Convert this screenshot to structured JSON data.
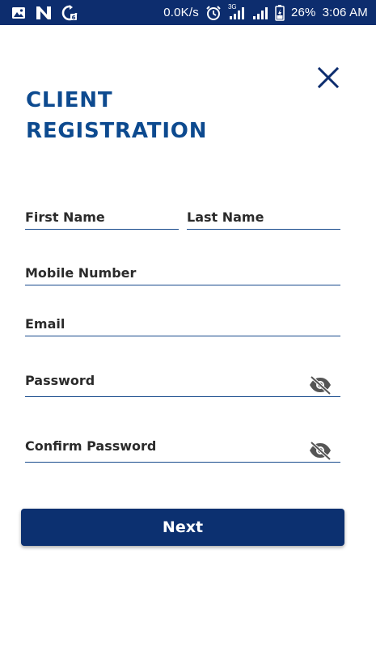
{
  "status_bar": {
    "network_speed": "0.0K/s",
    "network_type": "3G",
    "battery": "26%",
    "time": "3:06 AM",
    "icons": [
      "image-icon",
      "n-icon",
      "sync-icon",
      "alarm-icon",
      "signal-icon",
      "signal-icon",
      "battery-icon"
    ]
  },
  "header": {
    "title_line1": "CLIENT",
    "title_line2": "REGISTRATION",
    "close_icon": "close-icon"
  },
  "form": {
    "first_name_label": "First Name",
    "last_name_label": "Last Name",
    "mobile_label": "Mobile Number",
    "email_label": "Email",
    "password_label": "Password",
    "confirm_password_label": "Confirm Password",
    "visibility_icon": "eye-off-icon"
  },
  "actions": {
    "next_label": "Next"
  },
  "colors": {
    "status_bar": "#0d2d6e",
    "title": "#0d4a8f",
    "underline": "#174a8c",
    "button": "#0c3070"
  }
}
